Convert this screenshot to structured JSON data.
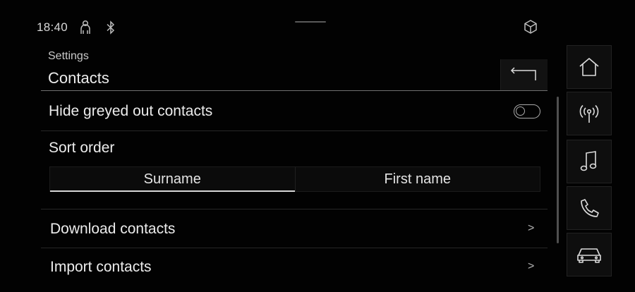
{
  "status": {
    "time": "18:40",
    "icons": [
      "person-icon",
      "bluetooth-icon",
      "cube-icon"
    ]
  },
  "header": {
    "breadcrumb": "Settings",
    "title": "Contacts",
    "back_icon": "back-arrow-icon"
  },
  "settings": {
    "hide_greyed": {
      "label": "Hide greyed out contacts",
      "enabled": false
    },
    "sort_order": {
      "label": "Sort order",
      "options": [
        "Surname",
        "First name"
      ],
      "selected": "Surname"
    },
    "items": [
      {
        "label": "Download contacts",
        "chevron": ">"
      },
      {
        "label": "Import contacts",
        "chevron": ">"
      }
    ]
  },
  "nav": {
    "items": [
      "home-icon",
      "radio-icon",
      "music-icon",
      "phone-icon",
      "car-icon"
    ]
  },
  "colors": {
    "background": "#020202",
    "text": "#ececec",
    "accent_line": "#d7d7d7"
  }
}
